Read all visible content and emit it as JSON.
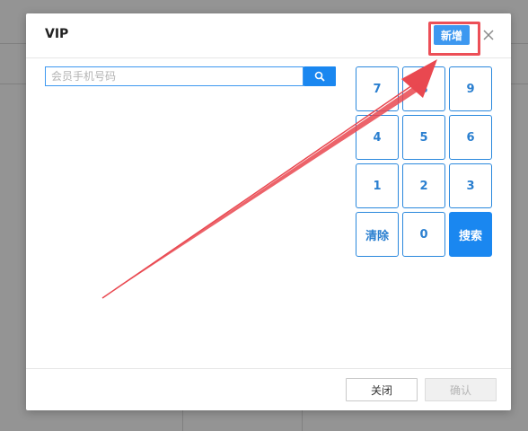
{
  "dialog": {
    "title": "VIP",
    "add_button_label": "新增",
    "close_icon": "close-icon"
  },
  "search": {
    "placeholder": "会员手机号码",
    "value": "",
    "button_icon": "search-icon"
  },
  "keypad": {
    "keys": [
      "7",
      "8",
      "9",
      "4",
      "5",
      "6",
      "1",
      "2",
      "3",
      "清除",
      "0",
      "搜索"
    ]
  },
  "footer": {
    "close_label": "关闭",
    "confirm_label": "确认"
  },
  "annotation": {
    "highlight_color": "#ec4f57",
    "arrow_color": "#e94850"
  },
  "colors": {
    "accent": "#1a87f0",
    "key_border": "#2a88dd"
  }
}
